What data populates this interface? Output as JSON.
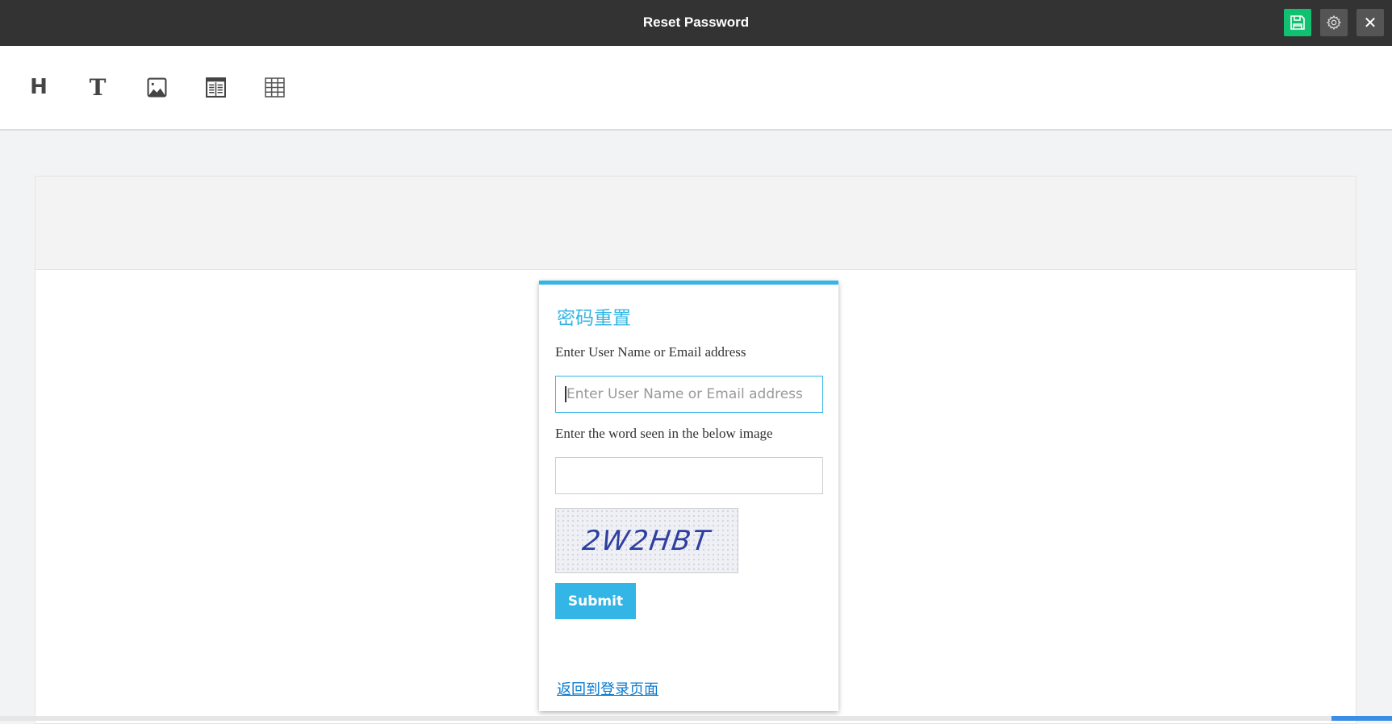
{
  "header": {
    "title": "Reset Password",
    "buttons": [
      {
        "icon": "save-icon"
      },
      {
        "icon": "gear-icon"
      },
      {
        "icon": "close-icon",
        "glyph": "✕"
      }
    ],
    "save_color": "#10c172"
  },
  "toolbar": {
    "tools": [
      {
        "icon": "heading-icon",
        "glyph": "H"
      },
      {
        "icon": "text-icon",
        "glyph": "T"
      },
      {
        "icon": "image-icon"
      },
      {
        "icon": "columns-icon"
      },
      {
        "icon": "table-icon"
      }
    ]
  },
  "form": {
    "title": "密码重置",
    "username_label": "Enter User Name or Email address",
    "username_placeholder": "Enter User Name or Email address",
    "username_value": "",
    "captcha_label": "Enter the word seen in the below image",
    "captcha_value": "",
    "captcha_text": "2W2HBT",
    "submit_label": "Submit",
    "back_link": "返回到登录页面",
    "accent": "#33b5e5"
  }
}
